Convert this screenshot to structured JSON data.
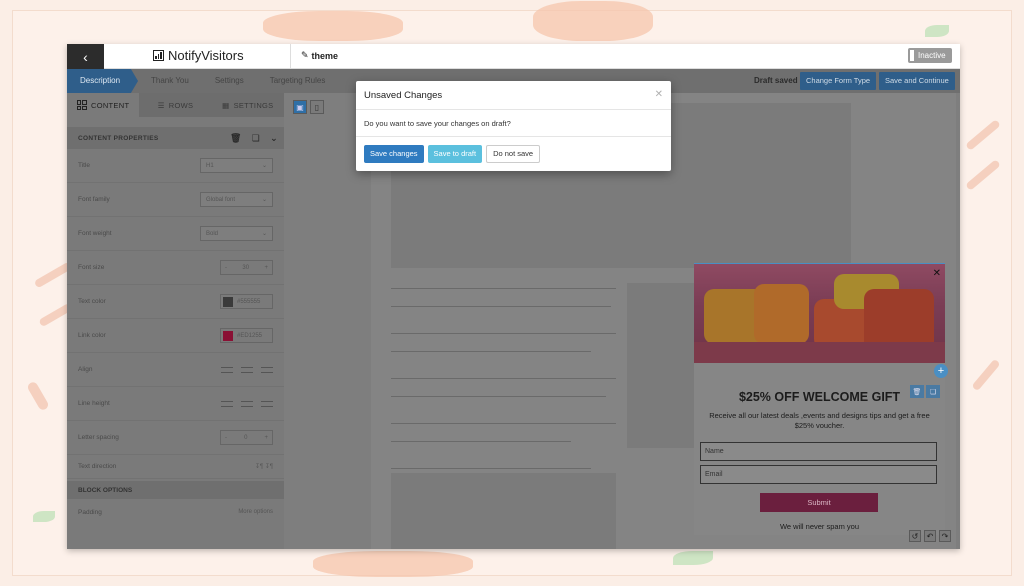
{
  "app": {
    "back_icon": "chevron-left-icon",
    "logo_text": "NotifyVisitors",
    "theme_label": "theme",
    "status_toggle": "Inactive"
  },
  "nav": {
    "tabs": [
      "Description",
      "Thank You",
      "Settings",
      "Targeting Rules"
    ],
    "draft_status": "Draft saved",
    "change_form_type": "Change Form Type",
    "save_continue": "Save and Continue"
  },
  "left_panel": {
    "tabs": [
      "CONTENT",
      "ROWS",
      "SETTINGS"
    ],
    "section_title": "CONTENT PROPERTIES",
    "properties": [
      {
        "label": "Title",
        "value": "H1"
      },
      {
        "label": "Font family",
        "value": "Global font"
      },
      {
        "label": "Font weight",
        "value": "Bold"
      },
      {
        "label": "Font size",
        "value": "30"
      },
      {
        "label": "Text color",
        "value": "#555555"
      },
      {
        "label": "Link color",
        "value": "#ED1255"
      },
      {
        "label": "Align"
      },
      {
        "label": "Line height"
      },
      {
        "label": "Letter spacing",
        "value": "0"
      },
      {
        "label": "Text direction"
      }
    ],
    "block_title": "BLOCK OPTIONS",
    "padding_label": "Padding",
    "more_options": "More options",
    "colors": {
      "text_swatch": "#3a3a3a",
      "link_swatch": "#8a1034"
    }
  },
  "popup": {
    "title": "$25% OFF WELCOME GIFT",
    "description": "Receive all our latest deals ,events and designs tips and get a free $25% voucher.",
    "name_placeholder": "Name",
    "email_placeholder": "Email",
    "submit_label": "Submit",
    "footer_text": "We will never spam you"
  },
  "modal": {
    "title": "Unsaved Changes",
    "message": "Do you want to save your changes on draft?",
    "save_changes": "Save changes",
    "save_draft": "Save to draft",
    "do_not_save": "Do not save"
  }
}
